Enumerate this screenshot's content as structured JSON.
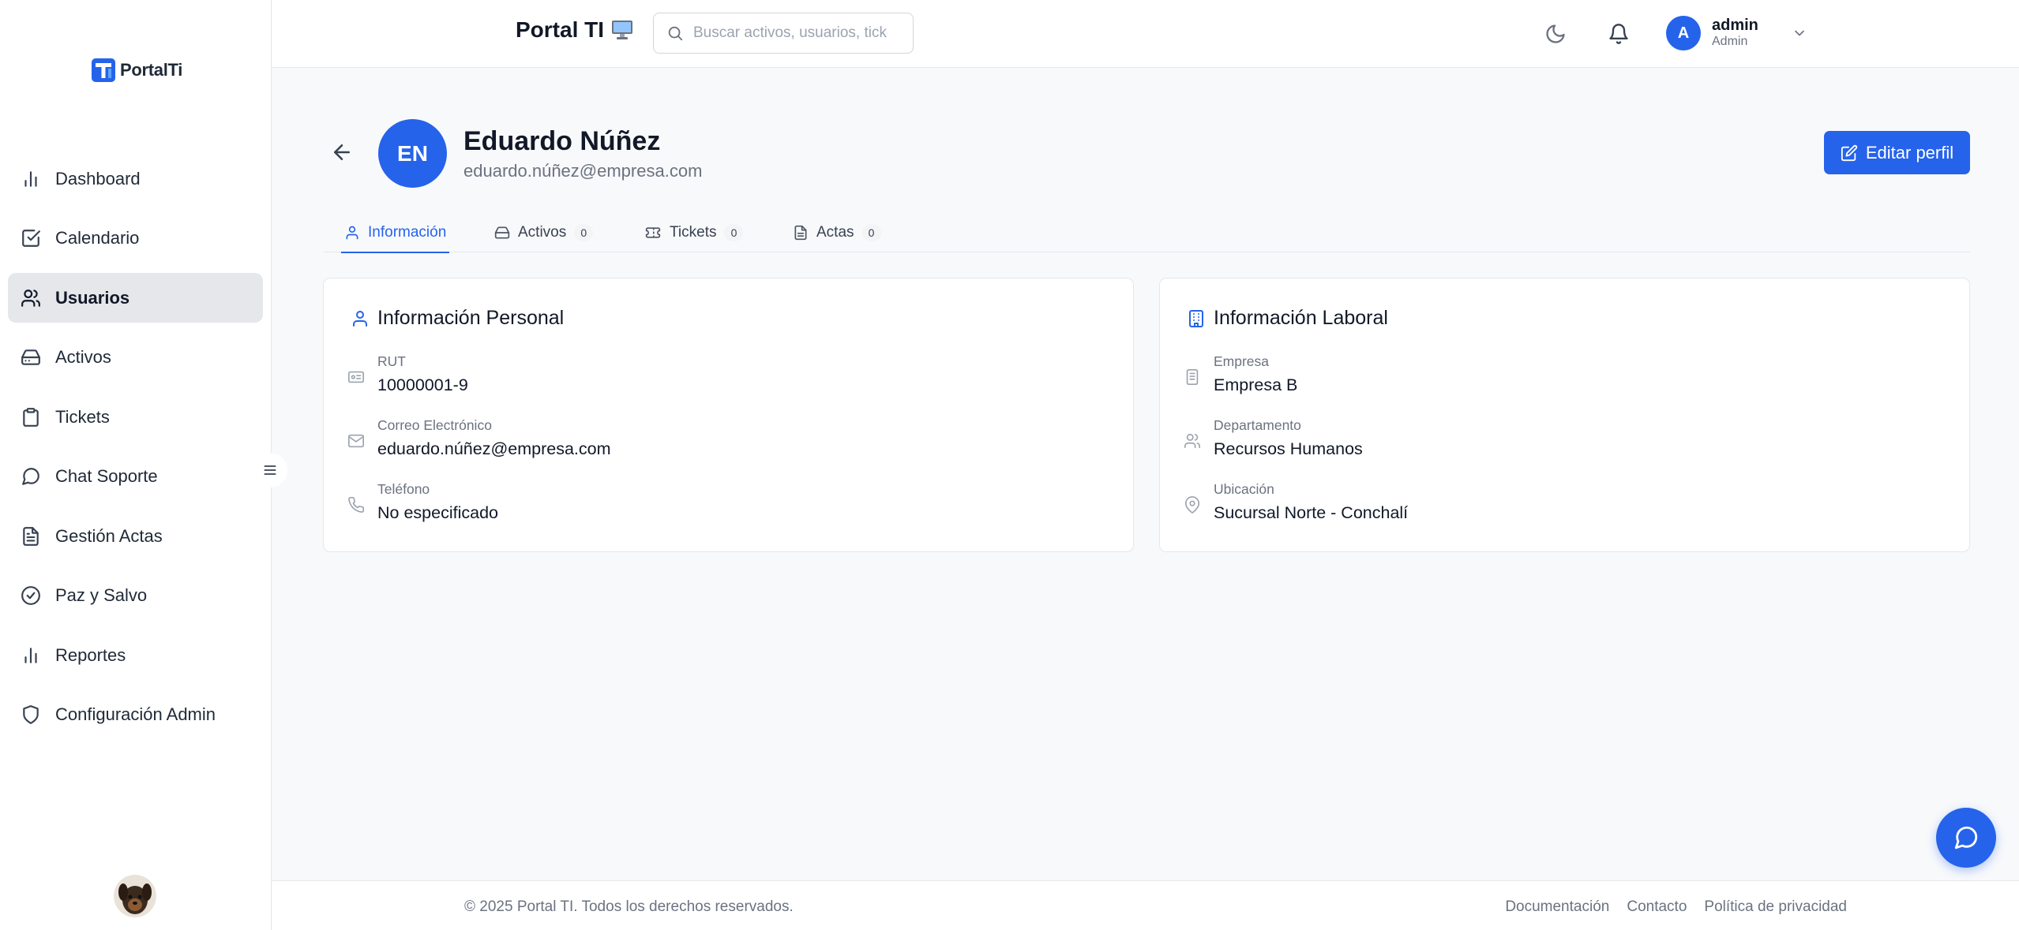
{
  "sidebar": {
    "logo": "PortalTi",
    "items": [
      {
        "label": "Dashboard",
        "icon": "bar-chart-icon"
      },
      {
        "label": "Calendario",
        "icon": "calendar-check-icon"
      },
      {
        "label": "Usuarios",
        "icon": "users-icon",
        "active": true
      },
      {
        "label": "Activos",
        "icon": "hard-drive-icon"
      },
      {
        "label": "Tickets",
        "icon": "clipboard-icon"
      },
      {
        "label": "Chat Soporte",
        "icon": "message-circle-icon"
      },
      {
        "label": "Gestión Actas",
        "icon": "file-text-icon"
      },
      {
        "label": "Paz y Salvo",
        "icon": "check-circle-icon"
      },
      {
        "label": "Reportes",
        "icon": "bar-chart-icon"
      },
      {
        "label": "Configuración Admin",
        "icon": "shield-icon"
      }
    ]
  },
  "header": {
    "title": "Portal TI",
    "search_placeholder": "Buscar activos, usuarios, tickets...",
    "user": {
      "initial": "A",
      "name": "admin",
      "role": "Admin"
    }
  },
  "profile": {
    "initials": "EN",
    "name": "Eduardo Núñez",
    "email": "eduardo.núñez@empresa.com",
    "edit_label": "Editar perfil"
  },
  "tabs": [
    {
      "label": "Información",
      "active": true
    },
    {
      "label": "Activos",
      "count": "0"
    },
    {
      "label": "Tickets",
      "count": "0"
    },
    {
      "label": "Actas",
      "count": "0"
    }
  ],
  "personal": {
    "title": "Información Personal",
    "fields": [
      {
        "label": "RUT",
        "value": "10000001-9"
      },
      {
        "label": "Correo Electrónico",
        "value": "eduardo.núñez@empresa.com"
      },
      {
        "label": "Teléfono",
        "value": "No especificado"
      }
    ]
  },
  "work": {
    "title": "Información Laboral",
    "fields": [
      {
        "label": "Empresa",
        "value": "Empresa B"
      },
      {
        "label": "Departamento",
        "value": "Recursos Humanos"
      },
      {
        "label": "Ubicación",
        "value": "Sucursal Norte - Conchalí"
      }
    ]
  },
  "footer": {
    "copyright": "© 2025 Portal TI. Todos los derechos reservados.",
    "links": [
      "Documentación",
      "Contacto",
      "Política de privacidad"
    ]
  },
  "colors": {
    "accent": "#2563eb",
    "sidebar_active": "#e5e7eb",
    "background": "#f8f9fb"
  }
}
